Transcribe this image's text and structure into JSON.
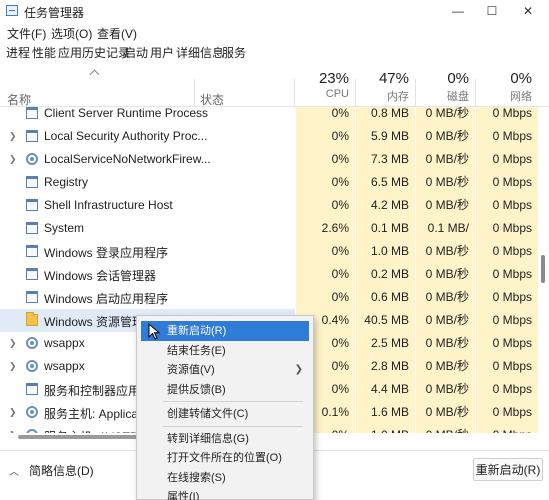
{
  "window": {
    "title": "任务管理器",
    "controls": {
      "minimize": "—",
      "maximize": "☐",
      "close": "✕"
    }
  },
  "menubar": [
    "文件(F)",
    "选项(O)",
    "查看(V)"
  ],
  "tabs": [
    "进程",
    "性能",
    "应用历史记录",
    "启动",
    "用户",
    "详细信息",
    "服务"
  ],
  "header": {
    "name": "名称",
    "status": "状态",
    "columns": [
      {
        "percent": "23%",
        "label": "CPU"
      },
      {
        "percent": "47%",
        "label": "内存"
      },
      {
        "percent": "0%",
        "label": "磁盘"
      },
      {
        "percent": "0%",
        "label": "网络"
      }
    ]
  },
  "processes": [
    {
      "name": "Client Server Runtime Process",
      "expandable": false,
      "icon": "window-icon",
      "cpu": "0%",
      "mem": "0.8 MB",
      "disk": "0 MB/秒",
      "net": "0 Mbps"
    },
    {
      "name": "Local Security Authority Proc...",
      "expandable": true,
      "icon": "window-icon",
      "cpu": "0%",
      "mem": "5.9 MB",
      "disk": "0 MB/秒",
      "net": "0 Mbps"
    },
    {
      "name": "LocalServiceNoNetworkFirew...",
      "expandable": true,
      "icon": "gear-icon",
      "cpu": "0%",
      "mem": "7.3 MB",
      "disk": "0 MB/秒",
      "net": "0 Mbps"
    },
    {
      "name": "Registry",
      "expandable": false,
      "icon": "window-icon",
      "cpu": "0%",
      "mem": "6.5 MB",
      "disk": "0 MB/秒",
      "net": "0 Mbps"
    },
    {
      "name": "Shell Infrastructure Host",
      "expandable": false,
      "icon": "window-icon",
      "cpu": "0%",
      "mem": "4.2 MB",
      "disk": "0 MB/秒",
      "net": "0 Mbps"
    },
    {
      "name": "System",
      "expandable": false,
      "icon": "window-icon",
      "cpu": "2.6%",
      "mem": "0.1 MB",
      "disk": "0.1 MB/秒",
      "net": "0 Mbps"
    },
    {
      "name": "Windows 登录应用程序",
      "expandable": false,
      "icon": "window-icon",
      "cpu": "0%",
      "mem": "1.0 MB",
      "disk": "0 MB/秒",
      "net": "0 Mbps"
    },
    {
      "name": "Windows 会话管理器",
      "expandable": false,
      "icon": "window-icon",
      "cpu": "0%",
      "mem": "0.2 MB",
      "disk": "0 MB/秒",
      "net": "0 Mbps"
    },
    {
      "name": "Windows 启动应用程序",
      "expandable": false,
      "icon": "window-icon",
      "cpu": "0%",
      "mem": "0.6 MB",
      "disk": "0 MB/秒",
      "net": "0 Mbps"
    },
    {
      "name": "Windows 资源管理器",
      "expandable": false,
      "icon": "folder-icon",
      "cpu": "0.4%",
      "mem": "40.5 MB",
      "disk": "0 MB/秒",
      "net": "0 Mbps",
      "selected": true
    },
    {
      "name": "wsappx",
      "expandable": true,
      "icon": "gear-icon",
      "cpu": "0%",
      "mem": "2.5 MB",
      "disk": "0 MB/秒",
      "net": "0 Mbps"
    },
    {
      "name": "wsappx",
      "expandable": true,
      "icon": "gear-icon",
      "cpu": "0%",
      "mem": "2.8 MB",
      "disk": "0 MB/秒",
      "net": "0 Mbps"
    },
    {
      "name": "服务和控制器应用",
      "expandable": false,
      "icon": "window-icon",
      "cpu": "0%",
      "mem": "4.4 MB",
      "disk": "0 MB/秒",
      "net": "0 Mbps"
    },
    {
      "name": "服务主机: Application",
      "expandable": true,
      "icon": "gear-icon",
      "cpu": "0.1%",
      "mem": "1.6 MB",
      "disk": "0 MB/秒",
      "net": "0 Mbps"
    },
    {
      "name": "服务主机: AVCTP 服务",
      "expandable": true,
      "icon": "gear-icon",
      "cpu": "0%",
      "mem": "1.0 MB",
      "disk": "0 MB/秒",
      "net": "0 Mbps"
    }
  ],
  "context_menu": [
    {
      "label": "重新启动(R)",
      "active": true
    },
    {
      "label": "结束任务(E)"
    },
    {
      "label": "资源值(V)",
      "submenu": true
    },
    {
      "label": "提供反馈(B)"
    },
    {
      "separator": true
    },
    {
      "label": "创建转储文件(C)"
    },
    {
      "separator": true
    },
    {
      "label": "转到详细信息(G)"
    },
    {
      "label": "打开文件所在的位置(O)"
    },
    {
      "label": "在线搜索(S)"
    },
    {
      "label": "属性(I)"
    }
  ],
  "footer": {
    "fewer_details": "简略信息(D)",
    "restart_button": "重新启动(R)"
  }
}
